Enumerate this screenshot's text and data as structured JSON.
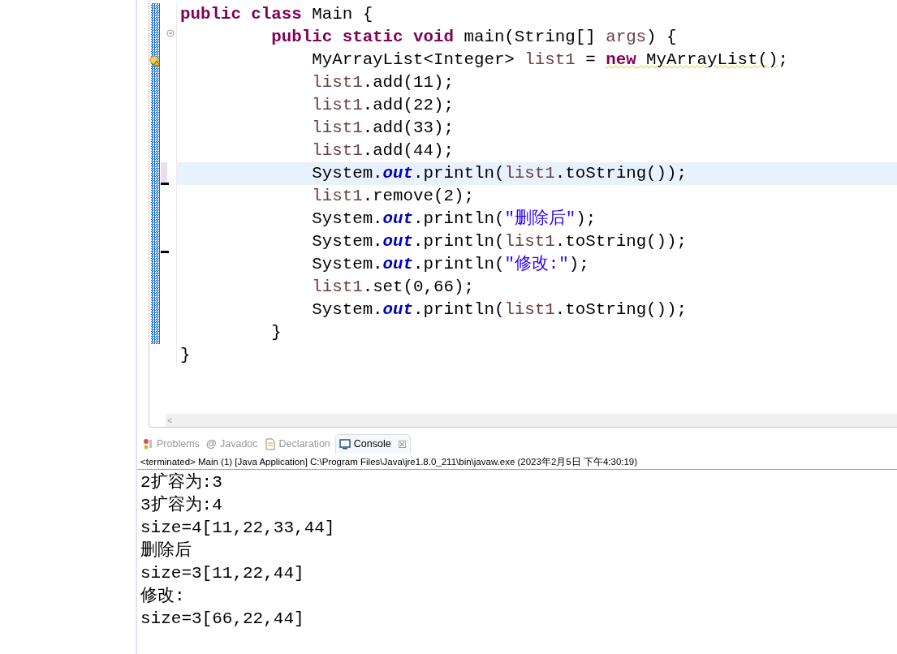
{
  "editor": {
    "lines": [
      {
        "current": false,
        "folding": false,
        "warning": false,
        "marker": false,
        "tokens": [
          {
            "kind": "keyword",
            "text": "public class"
          },
          {
            "kind": "plain",
            "text": " Main {"
          }
        ]
      },
      {
        "current": false,
        "folding": true,
        "warning": false,
        "marker": false,
        "tokens": [
          {
            "kind": "keyword",
            "text": "         public static void"
          },
          {
            "kind": "plain",
            "text": " main(String[] "
          },
          {
            "kind": "variable",
            "text": "args"
          },
          {
            "kind": "plain",
            "text": ") {"
          }
        ]
      },
      {
        "current": false,
        "folding": false,
        "warning": true,
        "marker": false,
        "tokens": [
          {
            "kind": "plain",
            "text": "             MyArrayList<Integer> "
          },
          {
            "kind": "variable",
            "text": "list1"
          },
          {
            "kind": "plain",
            "text": " = "
          },
          {
            "kind": "keyword",
            "text": "new",
            "underline": true
          },
          {
            "kind": "plain",
            "text": " MyArrayList()",
            "underline": true
          },
          {
            "kind": "plain",
            "text": ";"
          }
        ]
      },
      {
        "current": false,
        "folding": false,
        "warning": false,
        "marker": false,
        "tokens": [
          {
            "kind": "variable",
            "text": "             list1"
          },
          {
            "kind": "plain",
            "text": ".add(11);"
          }
        ]
      },
      {
        "current": false,
        "folding": false,
        "warning": false,
        "marker": false,
        "tokens": [
          {
            "kind": "variable",
            "text": "             list1"
          },
          {
            "kind": "plain",
            "text": ".add(22);"
          }
        ]
      },
      {
        "current": false,
        "folding": false,
        "warning": false,
        "marker": false,
        "tokens": [
          {
            "kind": "variable",
            "text": "             list1"
          },
          {
            "kind": "plain",
            "text": ".add(33);"
          }
        ]
      },
      {
        "current": false,
        "folding": false,
        "warning": false,
        "marker": false,
        "tokens": [
          {
            "kind": "variable",
            "text": "             list1"
          },
          {
            "kind": "plain",
            "text": ".add(44);"
          }
        ]
      },
      {
        "current": true,
        "folding": false,
        "warning": false,
        "marker": true,
        "tokens": [
          {
            "kind": "plain",
            "text": "             System."
          },
          {
            "kind": "field",
            "text": "out"
          },
          {
            "kind": "plain",
            "text": ".println("
          },
          {
            "kind": "variable",
            "text": "list1"
          },
          {
            "kind": "plain",
            "text": ".toString());"
          }
        ]
      },
      {
        "current": false,
        "folding": false,
        "warning": false,
        "marker": false,
        "tokens": [
          {
            "kind": "variable",
            "text": "             list1"
          },
          {
            "kind": "plain",
            "text": ".remove(2);"
          }
        ]
      },
      {
        "current": false,
        "folding": false,
        "warning": false,
        "marker": false,
        "tokens": [
          {
            "kind": "plain",
            "text": "             System."
          },
          {
            "kind": "field",
            "text": "out"
          },
          {
            "kind": "plain",
            "text": ".println("
          },
          {
            "kind": "string",
            "text": "\"删除后\""
          },
          {
            "kind": "plain",
            "text": ");"
          }
        ]
      },
      {
        "current": false,
        "folding": false,
        "warning": false,
        "marker": true,
        "tokens": [
          {
            "kind": "plain",
            "text": "             System."
          },
          {
            "kind": "field",
            "text": "out"
          },
          {
            "kind": "plain",
            "text": ".println("
          },
          {
            "kind": "variable",
            "text": "list1"
          },
          {
            "kind": "plain",
            "text": ".toString());"
          }
        ]
      },
      {
        "current": false,
        "folding": false,
        "warning": false,
        "marker": false,
        "tokens": [
          {
            "kind": "plain",
            "text": "             System."
          },
          {
            "kind": "field",
            "text": "out"
          },
          {
            "kind": "plain",
            "text": ".println("
          },
          {
            "kind": "string",
            "text": "\"修改:\""
          },
          {
            "kind": "plain",
            "text": ");"
          }
        ]
      },
      {
        "current": false,
        "folding": false,
        "warning": false,
        "marker": false,
        "tokens": [
          {
            "kind": "variable",
            "text": "             list1"
          },
          {
            "kind": "plain",
            "text": ".set(0,66);"
          }
        ]
      },
      {
        "current": false,
        "folding": false,
        "warning": false,
        "marker": false,
        "tokens": [
          {
            "kind": "plain",
            "text": "             System."
          },
          {
            "kind": "field",
            "text": "out"
          },
          {
            "kind": "plain",
            "text": ".println("
          },
          {
            "kind": "variable",
            "text": "list1"
          },
          {
            "kind": "plain",
            "text": ".toString());"
          }
        ]
      },
      {
        "current": false,
        "folding": false,
        "warning": false,
        "marker": false,
        "tokens": [
          {
            "kind": "plain",
            "text": "         }"
          }
        ]
      },
      {
        "current": false,
        "folding": false,
        "warning": false,
        "marker": false,
        "tokens": [
          {
            "kind": "plain",
            "text": "}"
          }
        ]
      }
    ],
    "scroll_arrow": "<"
  },
  "tabs": [
    {
      "label": "Problems",
      "selected": false
    },
    {
      "symbol": "@",
      "label": "Javadoc",
      "selected": false
    },
    {
      "label": "Declaration",
      "selected": false
    },
    {
      "label": "Console",
      "selected": true,
      "close": "☒"
    }
  ],
  "console": {
    "header": "<terminated> Main (1) [Java Application] C:\\Program Files\\Java\\jre1.8.0_211\\bin\\javaw.exe (2023年2月5日 下午4:30:19)",
    "output": [
      "2扩容为:3",
      "3扩容为:4",
      "size=4[11,22,33,44]",
      "删除后",
      "size=3[11,22,44]",
      "修改:",
      "size=3[66,22,44]"
    ]
  }
}
